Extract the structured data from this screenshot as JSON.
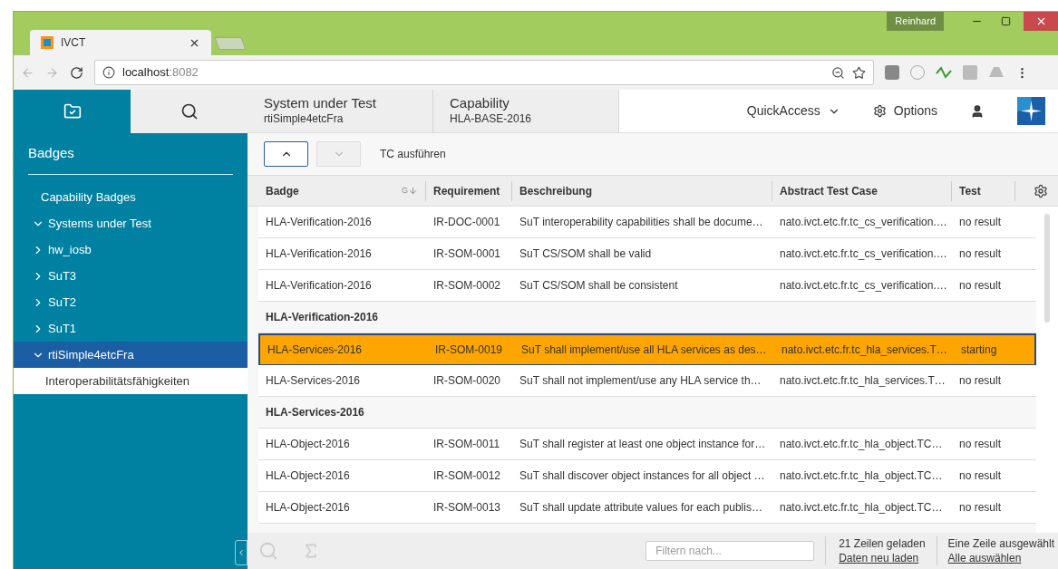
{
  "browser": {
    "tab_title": "IVCT",
    "user": "Reinhard",
    "url_host": "localhost",
    "url_port": ":8082"
  },
  "app_tabs": [
    {
      "kind": "folder",
      "selected": true
    },
    {
      "kind": "search",
      "selected": false
    }
  ],
  "context": [
    {
      "label": "System under Test",
      "value": "rtiSimple4etcFra"
    },
    {
      "label": "Capability",
      "value": "HLA-BASE-2016"
    }
  ],
  "header": {
    "quick_access": "QuickAccess",
    "options": "Options"
  },
  "sidebar": {
    "title": "Badges",
    "items": [
      {
        "label": "Capability Badges",
        "selected": false
      },
      {
        "label": "Systems under Test",
        "expanded": true,
        "selected": false,
        "children": [
          {
            "label": "hw_iosb",
            "expanded": false,
            "selected": false
          },
          {
            "label": "SuT3",
            "expanded": false,
            "selected": false
          },
          {
            "label": "SuT2",
            "expanded": false,
            "selected": false
          },
          {
            "label": "SuT1",
            "expanded": false,
            "selected": false
          },
          {
            "label": "rtiSimple4etcFra",
            "expanded": true,
            "selected": true,
            "children": [
              {
                "label": "Interoperabilitätsfähigkeiten",
                "selected": false
              }
            ]
          }
        ]
      }
    ]
  },
  "toolbar": {
    "up_disabled": false,
    "down_disabled": true,
    "run_label": "TC ausführen"
  },
  "table": {
    "columns": [
      "Badge",
      "Requirement",
      "Beschreibung",
      "Abstract Test Case",
      "Test"
    ],
    "sort_mark": "G",
    "rows": [
      {
        "kind": "row",
        "selected": false,
        "cells": [
          "HLA-Verification-2016",
          "IR-DOC-0001",
          "SuT interoperability capabilities shall be docume…",
          "nato.ivct.etc.fr.tc_cs_verification.…",
          "no result"
        ]
      },
      {
        "kind": "row",
        "selected": false,
        "cells": [
          "HLA-Verification-2016",
          "IR-SOM-0001",
          "SuT CS/SOM shall be valid",
          "nato.ivct.etc.fr.tc_cs_verification.…",
          "no result"
        ]
      },
      {
        "kind": "row",
        "selected": false,
        "cells": [
          "HLA-Verification-2016",
          "IR-SOM-0002",
          "SuT CS/SOM shall be consistent",
          "nato.ivct.etc.fr.tc_cs_verification.…",
          "no result"
        ]
      },
      {
        "kind": "group",
        "label": "HLA-Verification-2016"
      },
      {
        "kind": "row",
        "selected": true,
        "cells": [
          "HLA-Services-2016",
          "IR-SOM-0019",
          "SuT shall implement/use all HLA services as des…",
          "nato.ivct.etc.fr.tc_hla_services.T…",
          "starting"
        ]
      },
      {
        "kind": "row",
        "selected": false,
        "cells": [
          "HLA-Services-2016",
          "IR-SOM-0020",
          "SuT shall not implement/use any HLA service th…",
          "nato.ivct.etc.fr.tc_hla_services.T…",
          "no result"
        ]
      },
      {
        "kind": "group",
        "label": "HLA-Services-2016"
      },
      {
        "kind": "row",
        "selected": false,
        "cells": [
          "HLA-Object-2016",
          "IR-SOM-0011",
          "SuT shall register at least one object instance for…",
          "nato.ivct.etc.fr.tc_hla_object.TC…",
          "no result"
        ]
      },
      {
        "kind": "row",
        "selected": false,
        "cells": [
          "HLA-Object-2016",
          "IR-SOM-0012",
          "SuT shall discover object instances for all object …",
          "nato.ivct.etc.fr.tc_hla_object.TC…",
          "no result"
        ]
      },
      {
        "kind": "row",
        "selected": false,
        "cells": [
          "HLA-Object-2016",
          "IR-SOM-0013",
          "SuT shall update attribute values for each publis…",
          "nato.ivct.etc.fr.tc_hla_object.TC…",
          "no result"
        ]
      }
    ]
  },
  "footer": {
    "filter_placeholder": "Filtern nach...",
    "loaded": "21 Zeilen geladen",
    "reload": "Daten neu laden",
    "selected_info": "Eine Zeile ausgewählt",
    "select_all": "Alle auswählen"
  }
}
